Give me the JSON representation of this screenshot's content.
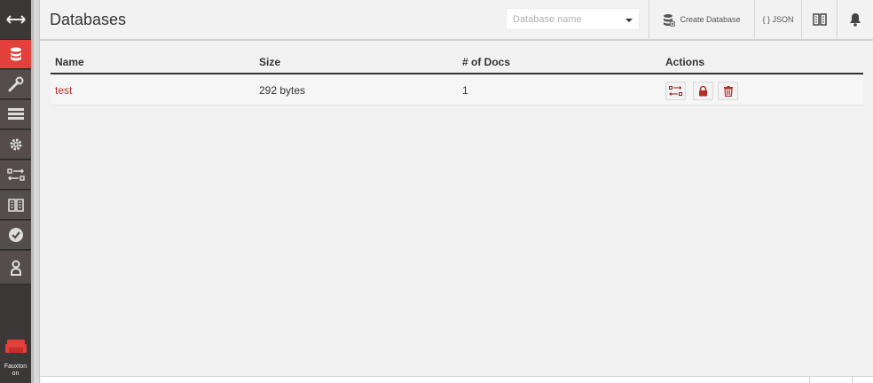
{
  "header": {
    "title": "Databases",
    "search": {
      "placeholder": "Database name",
      "value": ""
    },
    "create_label": "Create Database",
    "json_label": "{ } JSON"
  },
  "sidebar": {
    "items": [
      {
        "icon": "expand-arrows-icon",
        "label": "Toggle menu"
      },
      {
        "icon": "database-icon",
        "label": "Databases",
        "active": true
      },
      {
        "icon": "wrench-icon",
        "label": "Setup"
      },
      {
        "icon": "list-icon",
        "label": "Active Tasks"
      },
      {
        "icon": "gear-icon",
        "label": "Configuration"
      },
      {
        "icon": "replicate-icon",
        "label": "Replication"
      },
      {
        "icon": "book-icon",
        "label": "Documentation"
      },
      {
        "icon": "check-icon",
        "label": "Verify"
      },
      {
        "icon": "user-icon",
        "label": "User"
      }
    ],
    "brand_text": "Fauxton on"
  },
  "table": {
    "columns": [
      "Name",
      "Size",
      "# of Docs",
      "Actions"
    ],
    "rows": [
      {
        "name": "test",
        "size": "292 bytes",
        "docs": "1"
      }
    ]
  },
  "colors": {
    "accent": "#e33f3b",
    "sidebar": "#3c3838",
    "link": "#b32d2a"
  }
}
